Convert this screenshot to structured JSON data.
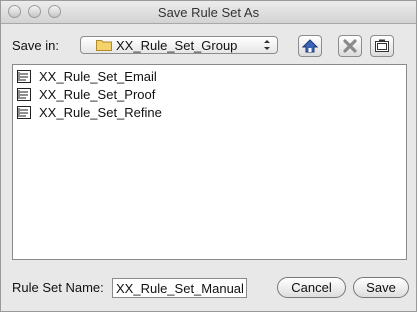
{
  "window": {
    "title": "Save Rule Set As"
  },
  "save_in": {
    "label": "Save in:",
    "selected": "XX_Rule_Set_Group"
  },
  "toolbar": {
    "icons": [
      "home-icon",
      "delete-icon",
      "new-folder-icon"
    ]
  },
  "files": [
    {
      "name": "XX_Rule_Set_Email"
    },
    {
      "name": "XX_Rule_Set_Proof"
    },
    {
      "name": "XX_Rule_Set_Refine"
    }
  ],
  "name_field": {
    "label": "Rule Set Name:",
    "value": "XX_Rule_Set_Manual"
  },
  "buttons": {
    "cancel": "Cancel",
    "save": "Save"
  },
  "colors": {
    "folder": "#f3d36a",
    "delete_icon": "#8a8a8a",
    "home_icon": "#3b63b5"
  }
}
